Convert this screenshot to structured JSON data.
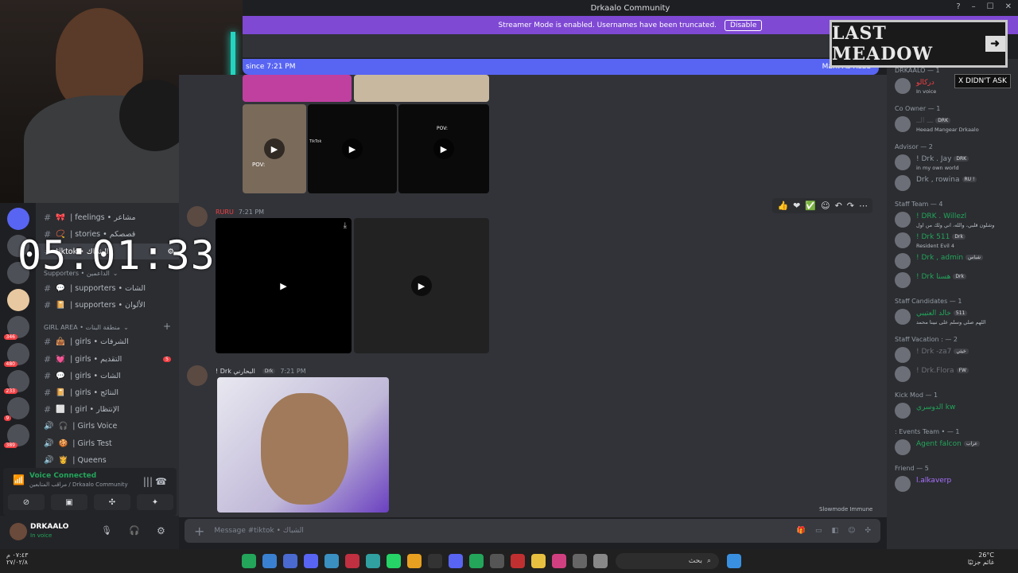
{
  "window": {
    "title": "Drkaalo Community"
  },
  "banner": {
    "text": "Streamer Mode is enabled. Usernames have been truncated.",
    "button": "Disable"
  },
  "new_messages": {
    "since": "since 7:21 PM",
    "mark": "Mark As Read"
  },
  "messages": [
    {
      "author": "RURU",
      "time": "7:21 PM"
    },
    {
      "author": "! Drk البحارني",
      "role": "Drk",
      "time": "7:21 PM"
    }
  ],
  "media_text": {
    "pov": "POV:",
    "tiktok": "TikTok"
  },
  "input": {
    "placeholder": "Message #tiktok • الشباك"
  },
  "slowmode": "Slowmode Immune",
  "overlay": {
    "timer": "05:01:33",
    "last_meadow": "LAST MEADOW",
    "didnt_ask": "X DIDN'T ASK"
  },
  "channels": {
    "top": [
      {
        "label": "| feelings • مشاعر",
        "emoji": "🎀"
      },
      {
        "label": "| stories • قصصكم",
        "emoji": "📿"
      },
      {
        "label": "tiktok • الشباك",
        "emoji": ""
      }
    ],
    "supporters_cat": "Supporters • الداعمين",
    "supporters": [
      {
        "label": "| supporters • الشات",
        "emoji": "💬"
      },
      {
        "label": "| supporters • الألوان",
        "emoji": "📔"
      }
    ],
    "girl_cat": "GIRL AREA • منطقة البنات",
    "girls": [
      {
        "label": "| girls • الشرفات",
        "emoji": "👜",
        "icon": "#"
      },
      {
        "label": "| girls • التقديم",
        "emoji": "💓",
        "icon": "#",
        "badge": "5"
      },
      {
        "label": "| girls • الشات",
        "emoji": "💬",
        "icon": "#"
      },
      {
        "label": "| girls • النتائج",
        "emoji": "📔",
        "icon": "#"
      },
      {
        "label": "| girl • الإنتظار",
        "emoji": "⬜",
        "icon": "#"
      },
      {
        "label": "| Girls Voice",
        "emoji": "🎧",
        "icon": "🔊"
      },
      {
        "label": "| Girls Test",
        "emoji": "🍪",
        "icon": "🔊"
      },
      {
        "label": "| Queens",
        "emoji": "👸",
        "icon": "🔊"
      }
    ]
  },
  "servers": {
    "badges": [
      "346",
      "480",
      "233",
      "9",
      "389"
    ]
  },
  "voice": {
    "title": "Voice Connected",
    "sub": "مراقب المتابعين / Drkaalo Community"
  },
  "user": {
    "name": "DRKAALO",
    "status": "In voice"
  },
  "members": [
    {
      "cat": "DRKAALO — 1",
      "items": [
        {
          "name": "دركالو",
          "status": "In voice",
          "color": "#f23f43"
        }
      ]
    },
    {
      "cat": "Co Owner — 1",
      "items": [
        {
          "name": "ـــ الــ",
          "tag": "DRK",
          "status": "Heead Mangear Drkaalo",
          "color": "#4e5058"
        }
      ]
    },
    {
      "cat": "Advisor — 2",
      "items": [
        {
          "name": "! Drk . Jay",
          "tag": "DRK",
          "status": "in my own world",
          "color": "#949ba4"
        },
        {
          "name": "Drk , rowina",
          "tag": "RU !",
          "status": "",
          "color": "#949ba4"
        }
      ]
    },
    {
      "cat": "Staff Team — 4",
      "items": [
        {
          "name": "! DRK . Willezl",
          "tag": "",
          "status": "وشلون قلبي، والله، اني ولك من اول",
          "color": "#23a55a"
        },
        {
          "name": "! Drk 511",
          "tag": "Drk",
          "status": "Resident Evil 4",
          "color": "#23a55a"
        },
        {
          "name": "! Drk , admin",
          "tag": "شباس",
          "status": "",
          "color": "#23a55a"
        },
        {
          "name": "! Drk هستا",
          "tag": "Drk",
          "status": "",
          "color": "#23a55a"
        }
      ]
    },
    {
      "cat": "Staff Candidates — 1",
      "items": [
        {
          "name": "خالد العتيبي",
          "tag": "511",
          "status": "اللهم صلي وسلم على نبينا محمد",
          "color": "#23a55a"
        }
      ]
    },
    {
      "cat": "Staff Vacation : — 2",
      "items": [
        {
          "name": "! Drk -za7",
          "tag": "خيثي",
          "status": "",
          "color": "#6d6f78"
        },
        {
          "name": "! Drk.Flora",
          "tag": "FW",
          "status": "",
          "color": "#6d6f78"
        }
      ]
    },
    {
      "cat": "Kick Mod — 1",
      "items": [
        {
          "name": "الدوسري kw",
          "tag": "",
          "status": "",
          "color": "#23a55a"
        }
      ]
    },
    {
      "cat": ": Events Team • — 1",
      "items": [
        {
          "name": "Agent falcon",
          "tag": "عراب",
          "status": "",
          "color": "#23a55a"
        }
      ]
    },
    {
      "cat": "Friend — 5",
      "items": [
        {
          "name": "l.alkaverp",
          "tag": "",
          "status": "",
          "color": "#a970ff"
        }
      ]
    }
  ],
  "taskbar": {
    "time": "٠٧:٤٣ م",
    "date": "٢٧/٠٢/٨",
    "search": "بحث",
    "temp": "26°C",
    "weather_label": "غائم جزئيًا"
  }
}
